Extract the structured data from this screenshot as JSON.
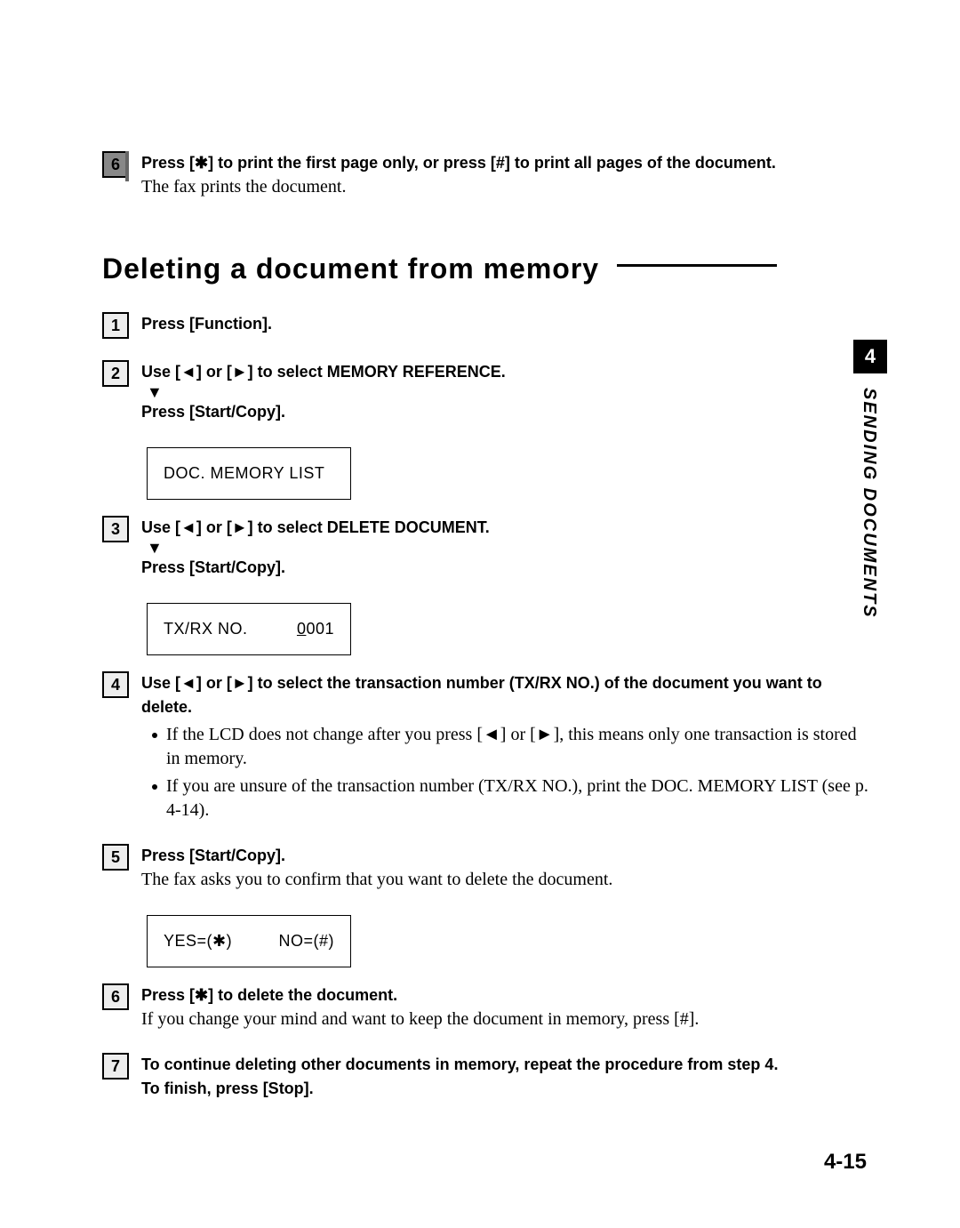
{
  "topStep": {
    "num": "6",
    "boldA": "Press [",
    "starA": "✱",
    "boldB": "] to print the first page only, or press [#] to print all pages of the document.",
    "desc": "The fax prints the document."
  },
  "heading": "Deleting a document from memory",
  "steps": {
    "s1": {
      "num": "1",
      "text": "Press [Function]."
    },
    "s2": {
      "num": "2",
      "line1a": "Use [",
      "left": "◄",
      "line1b": "] or [",
      "right": "►",
      "line1c": "] to select MEMORY REFERENCE.",
      "line2": "Press [Start/Copy].",
      "lcd": "DOC. MEMORY LIST"
    },
    "s3": {
      "num": "3",
      "line1a": "Use [",
      "left": "◄",
      "line1b": "] or [",
      "right": "►",
      "line1c": "]  to select DELETE DOCUMENT.",
      "line2": "Press [Start/Copy].",
      "lcdL": "TX/RX NO.",
      "lcdR0": "0",
      "lcdR1": "001"
    },
    "s4": {
      "num": "4",
      "line1a": "Use [",
      "left": "◄",
      "line1b": "] or [",
      "right": "►",
      "line1c": "]  to select the transaction number (TX/RX NO.) of the document you want to delete.",
      "b1a": "If the LCD does not change after you press [",
      "b1left": "◄",
      "b1b": "] or [",
      "b1right": "►",
      "b1c": "], this means only one transaction is stored in memory.",
      "b2": "If you are unsure of the transaction number (TX/RX NO.), print the DOC. MEMORY LIST (see p. 4-14)."
    },
    "s5": {
      "num": "5",
      "bold": "Press [Start/Copy].",
      "desc": "The fax asks you to confirm that you want to delete the document.",
      "lcdL": "YES=(✱)",
      "lcdR": "NO=(#)"
    },
    "s6": {
      "num": "6",
      "boldA": "Press [",
      "star": "✱",
      "boldB": "] to delete the document.",
      "desc": "If you change your mind and want to keep the document in memory, press [#]."
    },
    "s7": {
      "num": "7",
      "line1": "To continue deleting other documents in memory, repeat the procedure from step 4.",
      "line2": "To finish, press [Stop]."
    }
  },
  "tab": {
    "num": "4",
    "label": "SENDING DOCUMENTS"
  },
  "pageNum": "4-15"
}
